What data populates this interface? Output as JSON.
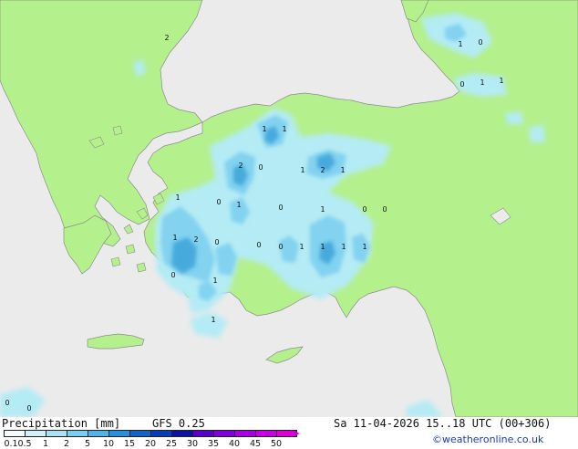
{
  "map": {
    "title": "Precipitation [mm]",
    "model": "GFS 0.25",
    "valid_time": "Sa 11-04-2026 15..18 UTC (00+306)",
    "credit": "©weatheronline.co.uk",
    "colors": {
      "sea": "#ebebeb",
      "land": "#b4f08c",
      "coast": "#8c8c8c",
      "precip_light": "#b4ebf5",
      "precip_mid": "#82d2f0",
      "precip_heavy": "#46aadc"
    },
    "value_labels": [
      "2",
      "1",
      "0",
      "0",
      "1",
      "1",
      "1",
      "2",
      "0",
      "1",
      "2",
      "1",
      "1",
      "0",
      "1",
      "0",
      "1",
      "2",
      "0",
      "1",
      "0",
      "0",
      "1",
      "1",
      "1",
      "1",
      "1",
      "1",
      "0",
      "1",
      "0",
      "0",
      "0",
      "0"
    ]
  },
  "legend": {
    "colors": [
      "#f5fafc",
      "#d2f0fa",
      "#aae1f5",
      "#7dcdf0",
      "#50b4e6",
      "#2891dc",
      "#1464c8",
      "#0a3cb4",
      "#0a14a0",
      "#5a00c8",
      "#8200dc",
      "#aa00e6",
      "#c800e6",
      "#dc00d2"
    ],
    "ticks": [
      "0.1",
      "0.5",
      "1",
      "2",
      "5",
      "10",
      "15",
      "20",
      "25",
      "30",
      "35",
      "40",
      "45",
      "50"
    ]
  }
}
